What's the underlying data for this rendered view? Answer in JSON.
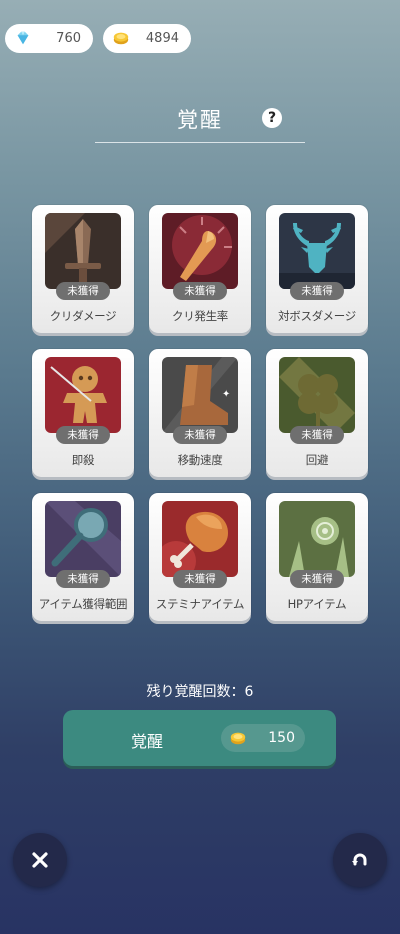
{
  "currency": {
    "gems": "760",
    "coins": "4894"
  },
  "header": {
    "title": "覚醒",
    "help_symbol": "?"
  },
  "skills": [
    {
      "label": "クリダメージ",
      "status": "未獲得",
      "icon": "sword-icon"
    },
    {
      "label": "クリ発生率",
      "status": "未獲得",
      "icon": "club-icon"
    },
    {
      "label": "対ボスダメージ",
      "status": "未獲得",
      "icon": "deer-icon"
    },
    {
      "label": "即殺",
      "status": "未獲得",
      "icon": "voodoo-doll-icon"
    },
    {
      "label": "移動速度",
      "status": "未獲得",
      "icon": "boot-icon"
    },
    {
      "label": "回避",
      "status": "未獲得",
      "icon": "clover-icon"
    },
    {
      "label": "アイテム獲得範囲",
      "status": "未獲得",
      "icon": "magnifier-icon"
    },
    {
      "label": "ステミナアイテム",
      "status": "未獲得",
      "icon": "meat-icon"
    },
    {
      "label": "HPアイテム",
      "status": "未獲得",
      "icon": "herb-icon"
    }
  ],
  "remaining_text": "残り覚醒回数：6",
  "awaken_button": {
    "label": "覚醒",
    "cost": "150"
  },
  "colors": {
    "button": "#3c8a80",
    "badge": "#6f6f6f"
  }
}
